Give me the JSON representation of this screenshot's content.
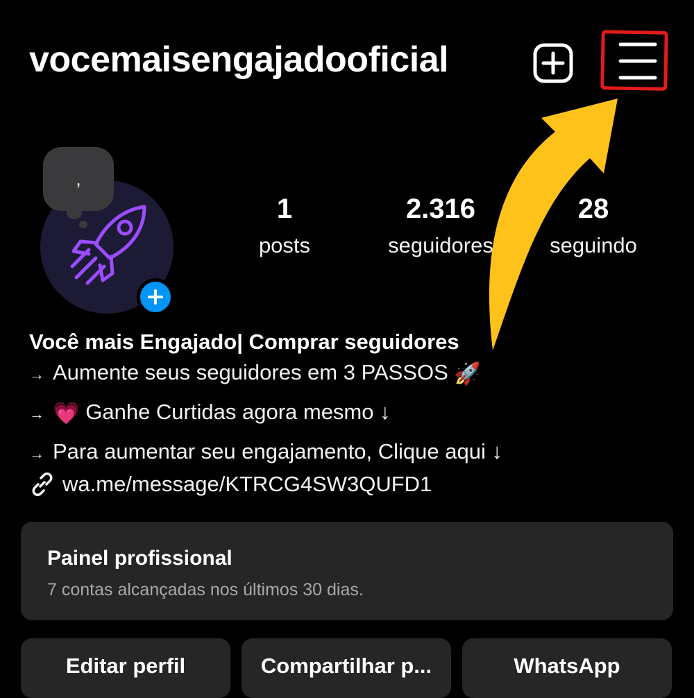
{
  "header": {
    "username": "vocemaisengajadooficial",
    "new_post_icon": "plus-square-icon",
    "menu_icon": "hamburger-menu-icon"
  },
  "avatar": {
    "note_text": ",",
    "add_story_icon": "plus-icon",
    "rocket_color": "#9b4dff"
  },
  "stats": {
    "posts": {
      "value": "1",
      "label": "posts"
    },
    "followers": {
      "value": "2.316",
      "label": "seguidores"
    },
    "following": {
      "value": "28",
      "label": "seguindo"
    }
  },
  "bio": {
    "name": "Você mais Engajado| Comprar seguidores",
    "arrow": "→",
    "line1": "Aumente seus seguidores em 3 PASSOS",
    "line1_emoji": "🚀",
    "line2_emoji": "💗",
    "line2": "Ganhe Curtidas agora mesmo ↓",
    "line3": "Para aumentar seu engajamento, Clique aqui ↓",
    "link": "wa.me/message/KTRCG4SW3QUFD1"
  },
  "pro_panel": {
    "title": "Painel profissional",
    "subtitle": "7 contas alcançadas nos últimos 30 dias."
  },
  "actions": {
    "edit": "Editar perfil",
    "share": "Compartilhar p...",
    "whatsapp": "WhatsApp"
  },
  "colors": {
    "background": "#000000",
    "panel": "#262626",
    "accent_blue": "#0095f6",
    "highlight_red": "#e21b1b",
    "annotation_arrow": "#ffc21a"
  }
}
